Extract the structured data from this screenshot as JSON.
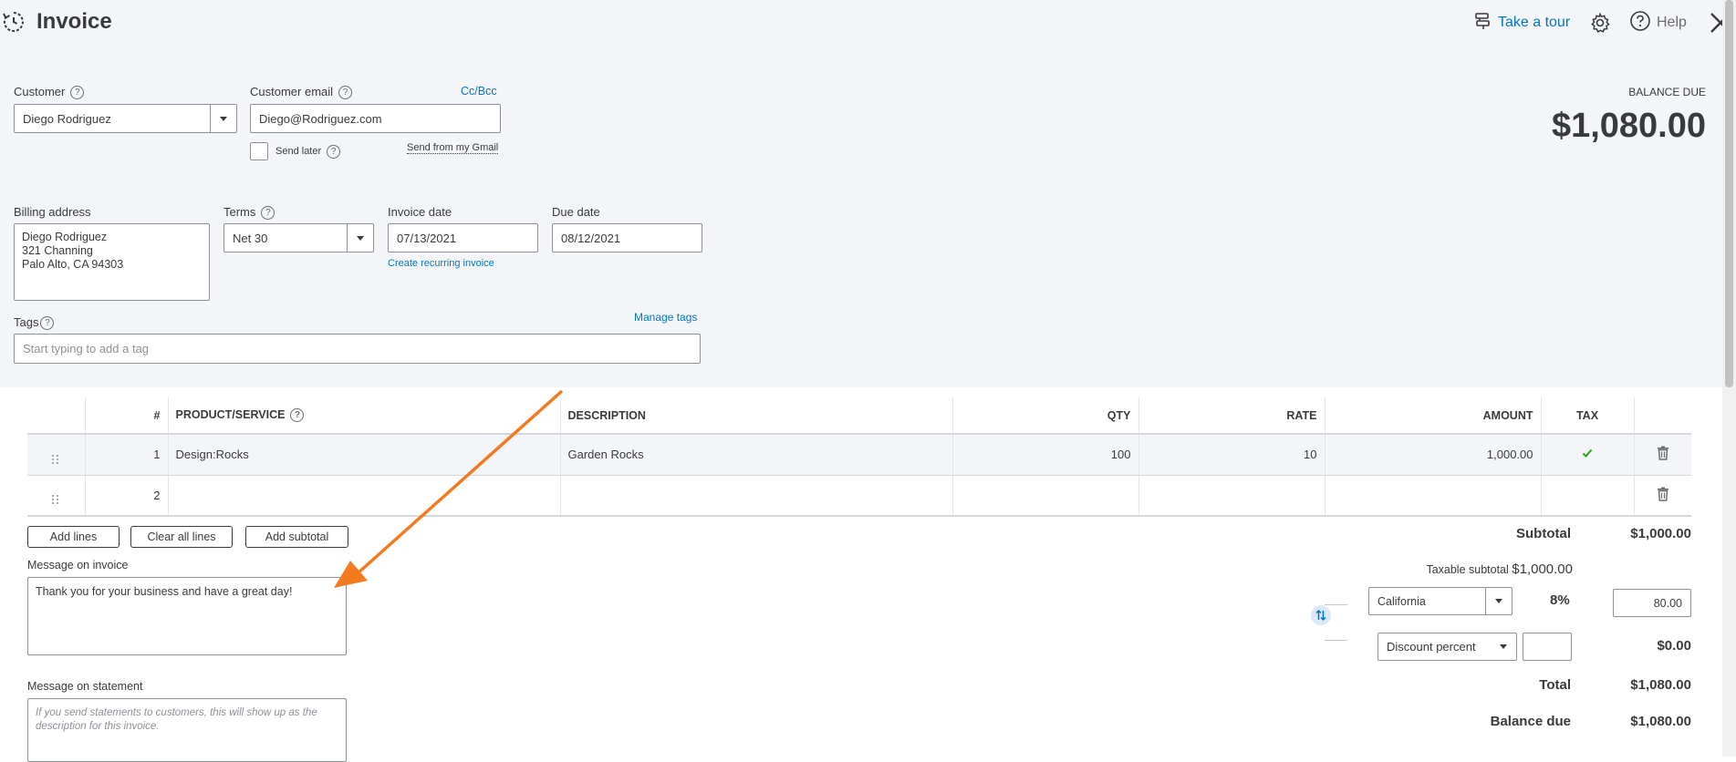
{
  "header": {
    "title": "Invoice",
    "tour_label": "Take a tour",
    "help_label": "Help",
    "icons": [
      "history-icon",
      "signpost-icon",
      "gear-icon",
      "help-icon",
      "close-icon"
    ]
  },
  "customer": {
    "label": "Customer",
    "value": "Diego Rodriguez",
    "email_label": "Customer email",
    "email_value": "Diego@Rodriguez.com",
    "cc_bcc": "Cc/Bcc",
    "send_later": "Send later",
    "send_from_gmail": "Send from my Gmail"
  },
  "balance": {
    "label": "BALANCE DUE",
    "amount": "$1,080.00"
  },
  "billing": {
    "label": "Billing address",
    "line1": "Diego Rodriguez",
    "line2": "321 Channing",
    "line3": "Palo Alto, CA  94303"
  },
  "terms": {
    "label": "Terms",
    "value": "Net 30"
  },
  "invoice_date": {
    "label": "Invoice date",
    "value": "07/13/2021",
    "recurring_link": "Create recurring invoice"
  },
  "due_date": {
    "label": "Due date",
    "value": "08/12/2021"
  },
  "tags": {
    "label": "Tags",
    "manage": "Manage tags",
    "placeholder": "Start typing to add a tag"
  },
  "table": {
    "headers": {
      "num": "#",
      "product": "PRODUCT/SERVICE",
      "description": "DESCRIPTION",
      "qty": "QTY",
      "rate": "RATE",
      "amount": "AMOUNT",
      "tax": "TAX"
    },
    "rows": [
      {
        "num": "1",
        "product": "Design:Rocks",
        "description": "Garden Rocks",
        "qty": "100",
        "rate": "10",
        "amount": "1,000.00",
        "taxed": true
      },
      {
        "num": "2",
        "product": "",
        "description": "",
        "qty": "",
        "rate": "",
        "amount": "",
        "taxed": false
      }
    ]
  },
  "buttons": {
    "add_lines": "Add lines",
    "clear_all": "Clear all lines",
    "add_subtotal": "Add subtotal"
  },
  "messages": {
    "invoice_label": "Message on invoice",
    "invoice_value": "Thank you for your business and have a great day!",
    "statement_label": "Message on statement",
    "statement_placeholder": "If you send statements to customers, this will show up as the description for this invoice."
  },
  "totals": {
    "subtotal_label": "Subtotal",
    "subtotal_value": "$1,000.00",
    "taxable_label": "Taxable subtotal",
    "taxable_value": "$1,000.00",
    "tax_region": "California",
    "tax_rate": "8%",
    "tax_amount": "80.00",
    "discount_type": "Discount percent",
    "discount_value": "",
    "discount_amount": "$0.00",
    "total_label": "Total",
    "total_value": "$1,080.00",
    "balance_due_label": "Balance due",
    "balance_due_value": "$1,080.00"
  },
  "colors": {
    "link": "#0077c5",
    "check": "#2ca01c",
    "arrow": "#f47a20",
    "top_bg": "#f4f5f8"
  }
}
